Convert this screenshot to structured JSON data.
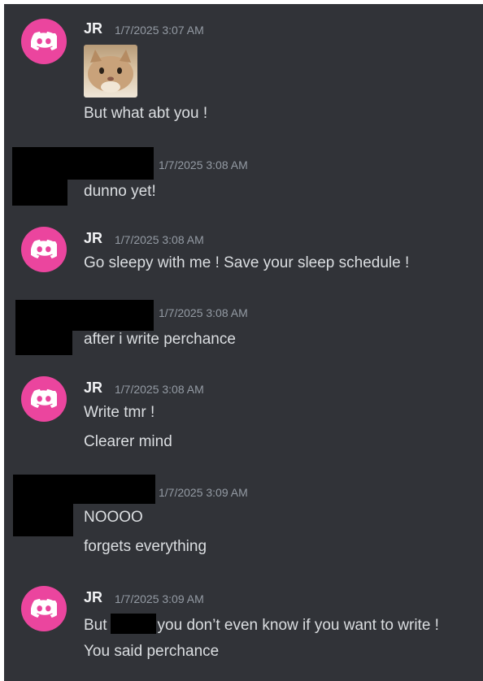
{
  "messages": [
    {
      "author": "JR",
      "timestamp": "1/7/2025 3:07 AM",
      "image_alt": "cat-image",
      "lines": [
        "But what abt you !"
      ]
    },
    {
      "author": "",
      "timestamp": "1/7/2025 3:08 AM",
      "lines": [
        "dunno yet!"
      ]
    },
    {
      "author": "JR",
      "timestamp": "1/7/2025 3:08 AM",
      "lines": [
        "Go sleepy with me ! Save your sleep schedule !"
      ]
    },
    {
      "author": "",
      "timestamp": "1/7/2025 3:08 AM",
      "lines": [
        "after i write perchance"
      ]
    },
    {
      "author": "JR",
      "timestamp": "1/7/2025 3:08 AM",
      "lines": [
        "Write tmr !",
        "Clearer mind"
      ]
    },
    {
      "author": "",
      "timestamp": "1/7/2025 3:09 AM",
      "lines": [
        "NOOOO",
        "forgets everything"
      ]
    },
    {
      "author": "JR",
      "timestamp": "1/7/2025 3:09 AM",
      "line1_before": "But",
      "line1_after": "you don’t even know if you want to write !",
      "lines": [
        "You said perchance"
      ]
    }
  ],
  "colors": {
    "background": "#313338",
    "avatar": "#eb459e",
    "username": "#f2f3f5",
    "timestamp": "#949ba4",
    "text": "#dbdee1"
  },
  "icons": {
    "avatar": "discord-logo-icon"
  }
}
